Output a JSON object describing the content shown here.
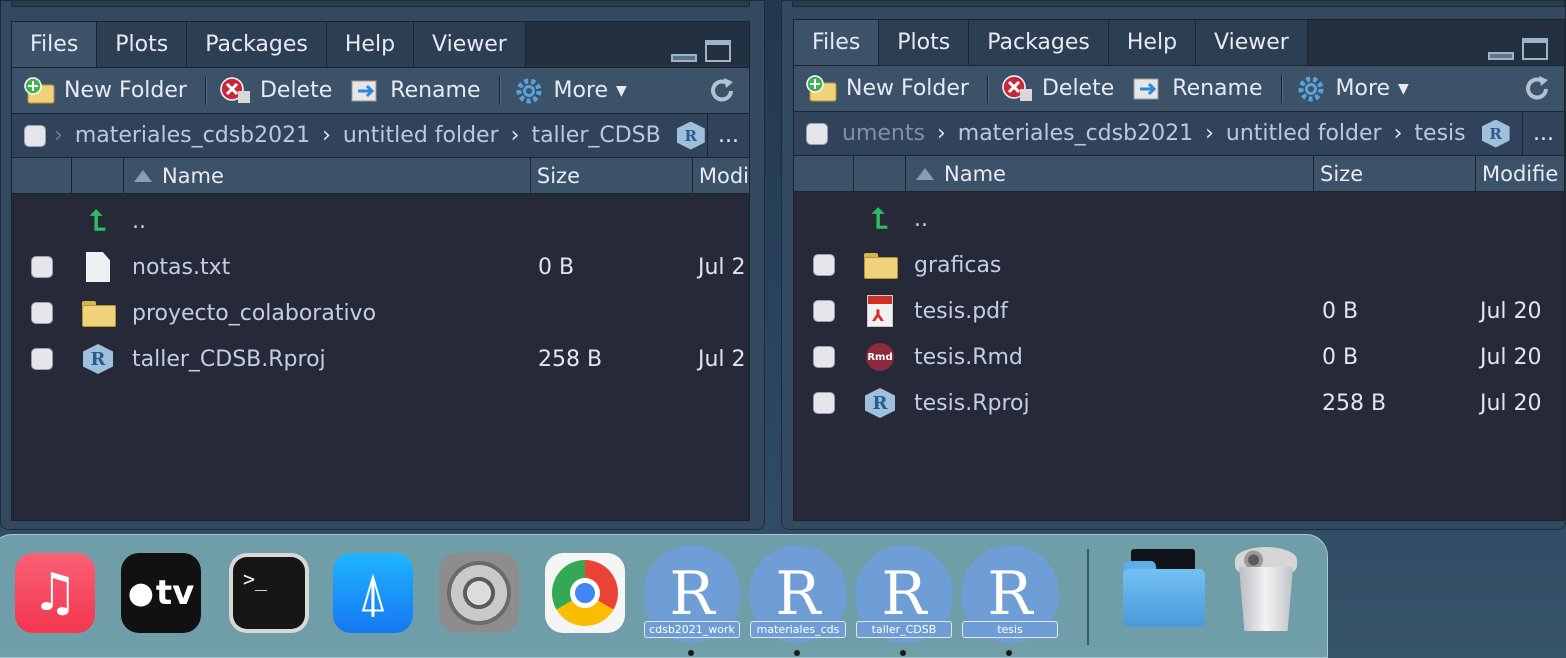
{
  "panes": [
    {
      "tabs": [
        "Files",
        "Plots",
        "Packages",
        "Help",
        "Viewer"
      ],
      "toolbar": {
        "new_folder": "New Folder",
        "delete": "Delete",
        "rename": "Rename",
        "more": "More"
      },
      "breadcrumb": [
        "materiales_cdsb2021",
        "untitled folder",
        "taller_CDSB"
      ],
      "ellipsis": "...",
      "columns": {
        "name": "Name",
        "size": "Size",
        "modified": "Modi"
      },
      "up": "..",
      "rows": [
        {
          "name": "notas.txt",
          "size": "0 B",
          "date": "Jul 2",
          "icon": "text-file-icon"
        },
        {
          "name": "proyecto_colaborativo",
          "size": "",
          "date": "",
          "icon": "folder-icon"
        },
        {
          "name": "taller_CDSB.Rproj",
          "size": "258 B",
          "date": "Jul 2",
          "icon": "rproj-icon"
        }
      ]
    },
    {
      "tabs": [
        "Files",
        "Plots",
        "Packages",
        "Help",
        "Viewer"
      ],
      "toolbar": {
        "new_folder": "New Folder",
        "delete": "Delete",
        "rename": "Rename",
        "more": "More"
      },
      "breadcrumb_lead": "uments",
      "breadcrumb": [
        "materiales_cdsb2021",
        "untitled folder",
        "tesis"
      ],
      "ellipsis": "...",
      "columns": {
        "name": "Name",
        "size": "Size",
        "modified": "Modifie"
      },
      "up": "..",
      "rows": [
        {
          "name": "graficas",
          "size": "",
          "date": "",
          "icon": "folder-icon"
        },
        {
          "name": "tesis.pdf",
          "size": "0 B",
          "date": "Jul 20",
          "icon": "pdf-icon"
        },
        {
          "name": "tesis.Rmd",
          "size": "0 B",
          "date": "Jul 20",
          "icon": "rmd-icon"
        },
        {
          "name": "tesis.Rproj",
          "size": "258 B",
          "date": "Jul 20",
          "icon": "rproj-icon"
        }
      ]
    }
  ],
  "dock": {
    "apps": [
      "music-icon",
      "apple-tv-icon",
      "terminal-icon",
      "app-store-icon",
      "system-settings-icon",
      "chrome-icon"
    ],
    "tv_label": "tv",
    "terminal_prompt": ">_",
    "rstudio_letter": "R",
    "rstudio_windows": [
      "cdsb2021_work",
      "materiales_cds",
      "taller_CDSB",
      "tesis"
    ]
  }
}
